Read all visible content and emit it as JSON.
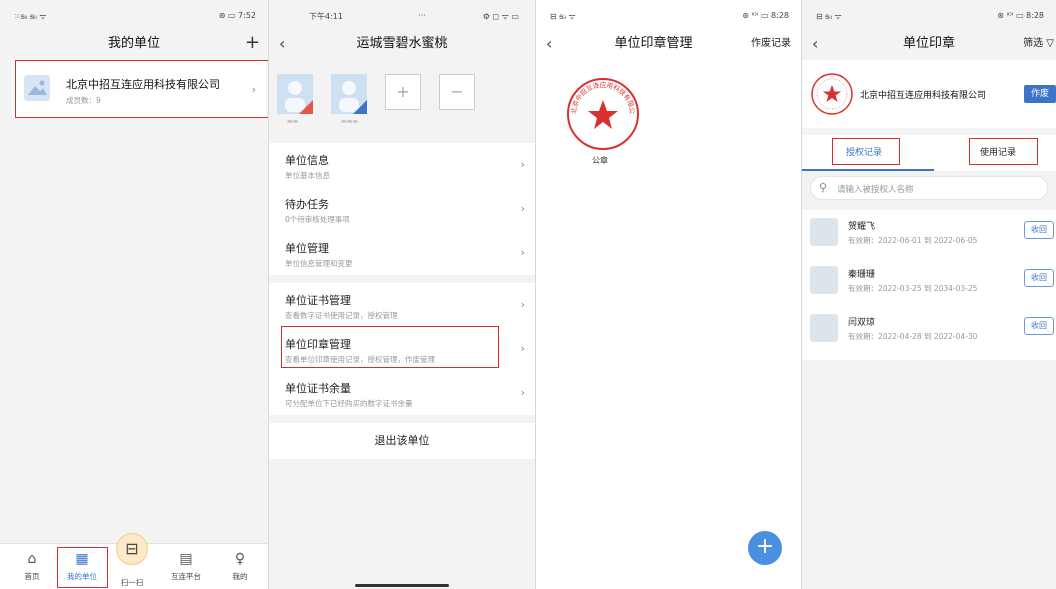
{
  "panel1": {
    "status_left": "⁙ᵴᵢₗ ᵴᵢₗ ᯤ",
    "status_right": "⊛ ▭ 7:52",
    "title": "我的单位",
    "add_icon": "+",
    "company_name": "北京中招互连应用科技有限公司",
    "member_count": "成员数：9",
    "tabs": [
      {
        "label": "首页",
        "icon": "⌂"
      },
      {
        "label": "我的单位",
        "icon": "▦"
      },
      {
        "label": "扫一扫",
        "icon": "⊟"
      },
      {
        "label": "互连平台",
        "icon": "▤"
      },
      {
        "label": "我的",
        "icon": "♀"
      }
    ]
  },
  "panel2": {
    "status_left": "下午4:11",
    "status_right": "⚙ ◻ ᯤ ▭",
    "status_center": "···",
    "title": "运城雪碧水蜜桃",
    "members": [
      "▬▬",
      "▬▬▬"
    ],
    "plus": "+",
    "minus": "−",
    "menu": [
      {
        "title": "单位信息",
        "sub": "单位基本信息"
      },
      {
        "title": "待办任务",
        "sub": "0个待审核处理事项"
      },
      {
        "title": "单位管理",
        "sub": "单位信息管理和变更"
      },
      {
        "title": "单位证书管理",
        "sub": "查看数字证书使用记录，授权管理"
      },
      {
        "title": "单位印章管理",
        "sub": "查看单位印章使用记录，授权管理，作废管理"
      },
      {
        "title": "单位证书余量",
        "sub": "可分配单位下已经购买的数字证书余量"
      }
    ],
    "exit_label": "退出该单位"
  },
  "panel3": {
    "status_left": "⊟ ᵴᵢₗ ᯤ",
    "status_right": "⊛ ᴵᴼᴵ ▭ 8:28",
    "title": "单位印章管理",
    "right_action": "作废记录",
    "seal_ring_text": "北京中招互连应用科技有限公司",
    "seal_label": "公章",
    "fab": "+"
  },
  "panel4": {
    "status_left": "⊟ ᵴᵢₗ ᯤ",
    "status_right": "⊛ ᴵᴼᴵ ▭ 8:28",
    "title": "单位印章",
    "filter_label": "筛选 ▽",
    "company_name": "北京中招互连应用科技有限公司",
    "void_button": "作废",
    "tab_auth": "授权记录",
    "tab_usage": "使用记录",
    "search_placeholder": "请输入被授权人名称",
    "records": [
      {
        "name": "贺耀飞",
        "validity": "有效期：2022-06-01 到 2022-06-05",
        "action": "收回"
      },
      {
        "name": "秦珊珊",
        "validity": "有效期：2022-03-25 到 2034-03-25",
        "action": "收回"
      },
      {
        "name": "闫双琼",
        "validity": "有效期：2022-04-28 到 2022-04-30",
        "action": "收回"
      }
    ],
    "colors": {
      "accent": "#3b74c9",
      "highlight": "#d62c2c"
    }
  }
}
